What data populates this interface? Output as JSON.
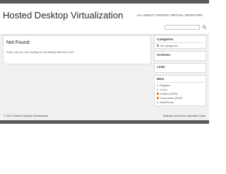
{
  "header": {
    "site_title": "Hosted Desktop Virtualization",
    "tagline": "ALL ABOUT HOSTED VIRTUAL DESKTOPS"
  },
  "search": {
    "placeholder": "",
    "value": "",
    "icon": "search-icon"
  },
  "content": {
    "title": "Not Found",
    "message": "Sorry, but you are looking for something that isn't here"
  },
  "sidebar": {
    "categories": {
      "title": "Categories",
      "items": [
        "No categories"
      ]
    },
    "archives": {
      "title": "Archives"
    },
    "links": {
      "title": "Links"
    },
    "meta": {
      "title": "Meta",
      "items": [
        {
          "label": "Register",
          "icon": "arrow-icon"
        },
        {
          "label": "Log in",
          "icon": "arrow-icon"
        },
        {
          "label": "Entries (RSS)",
          "icon": "rss-icon"
        },
        {
          "label": "Comments (RSS)",
          "icon": "rss-icon"
        },
        {
          "label": "WordPress",
          "icon": "arrow-icon"
        }
      ]
    }
  },
  "footer": {
    "copyright": "© 2011 Hosted Desktop Virtualization",
    "credit": "Suffusion theme by Sayontan Sinha"
  },
  "colors": {
    "bar": "#5a5a5a",
    "background": "#f0f0f0",
    "panel": "#ffffff",
    "rss": "#e07b1c"
  }
}
